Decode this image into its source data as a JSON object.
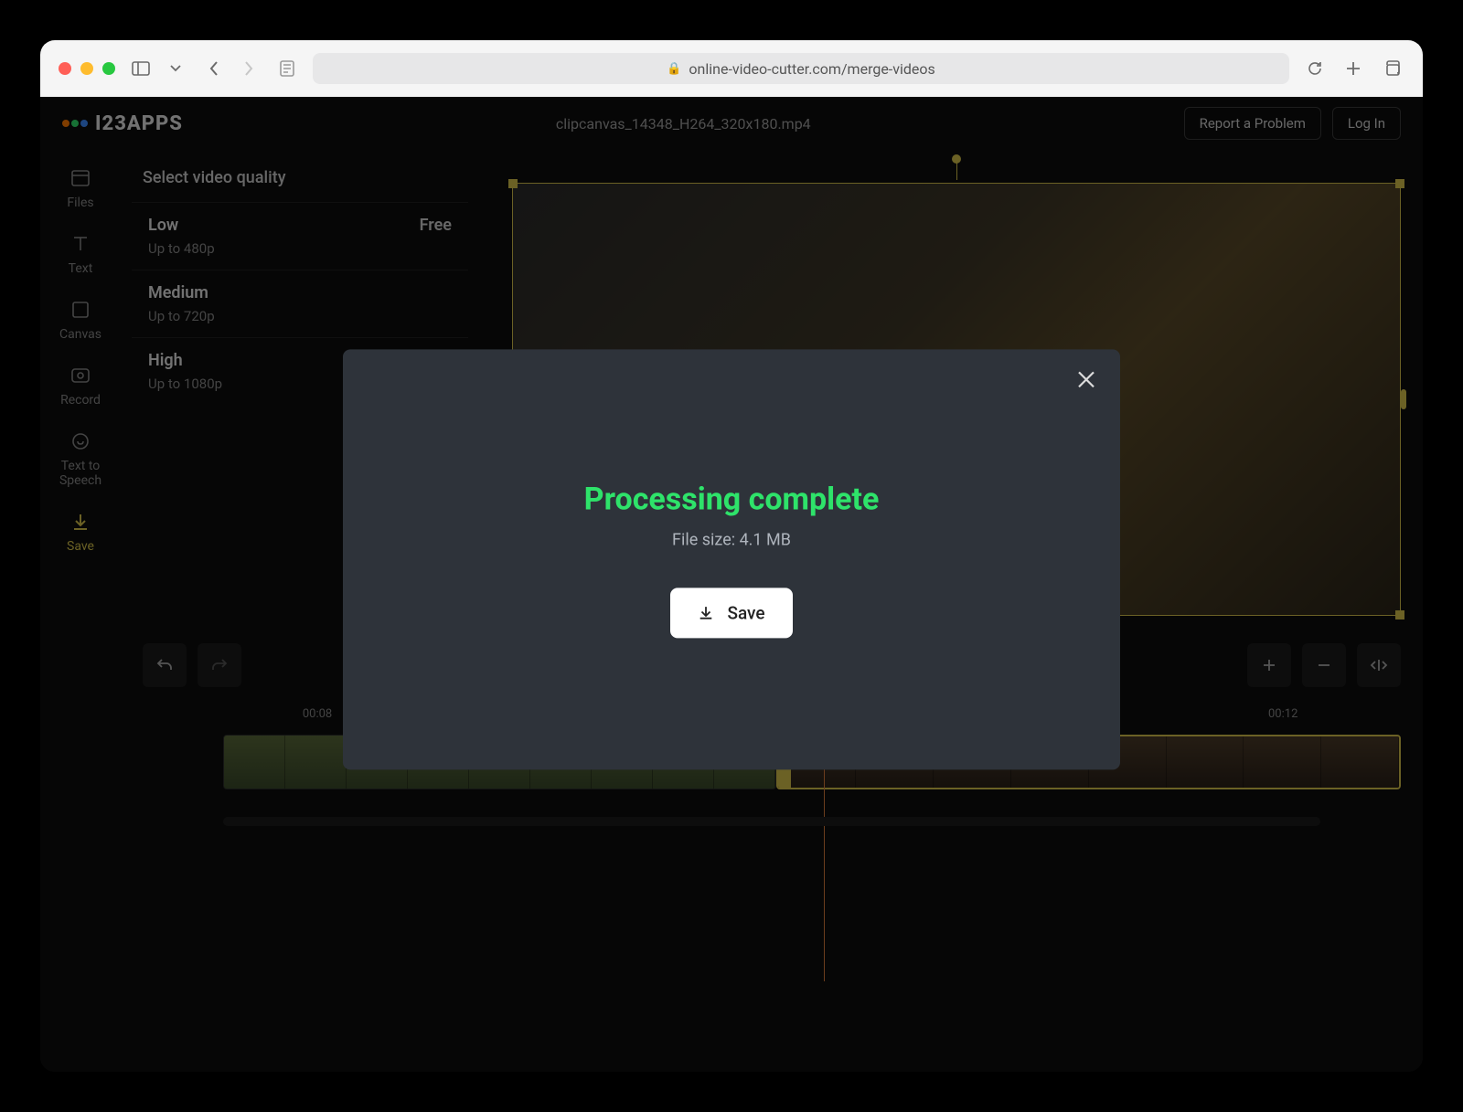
{
  "browser": {
    "url": "online-video-cutter.com/merge-videos"
  },
  "header": {
    "brand": "I23APPS",
    "filename": "clipcanvas_14348_H264_320x180.mp4",
    "report": "Report a Problem",
    "login": "Log In"
  },
  "sidebar": {
    "items": [
      {
        "key": "files",
        "label": "Files"
      },
      {
        "key": "text",
        "label": "Text"
      },
      {
        "key": "canvas",
        "label": "Canvas"
      },
      {
        "key": "record",
        "label": "Record"
      },
      {
        "key": "tts",
        "label": "Text to Speech"
      },
      {
        "key": "save",
        "label": "Save"
      }
    ]
  },
  "qualityPanel": {
    "title": "Select video quality",
    "options": [
      {
        "name": "Low",
        "sub": "Up to 480p",
        "badge": "Free"
      },
      {
        "name": "Medium",
        "sub": "Up to 720p",
        "badge": ""
      },
      {
        "name": "High",
        "sub": "Up to 1080p",
        "badge": ""
      }
    ]
  },
  "timeline": {
    "labelA": "00:08",
    "labelB": "00:12"
  },
  "modal": {
    "title": "Processing complete",
    "filesize": "File size: 4.1 MB",
    "save": "Save"
  }
}
